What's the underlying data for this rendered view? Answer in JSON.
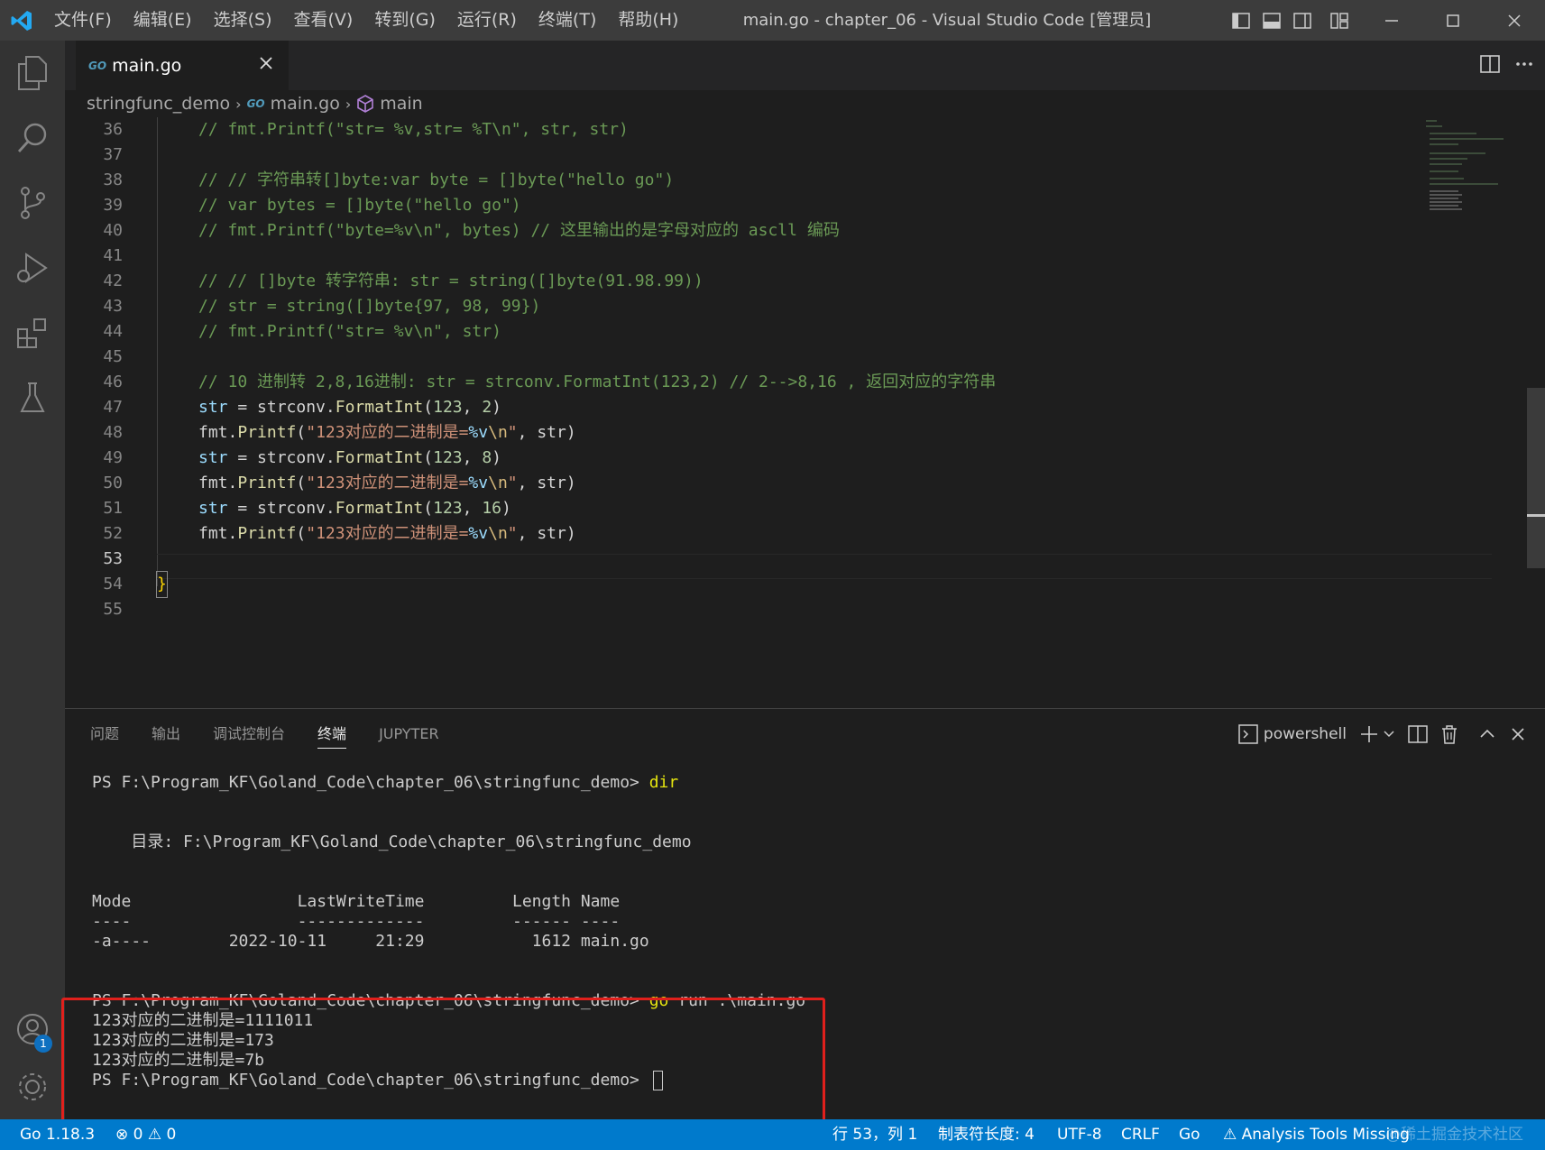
{
  "titlebar": {
    "menu": [
      "文件(F)",
      "编辑(E)",
      "选择(S)",
      "查看(V)",
      "转到(G)",
      "运行(R)",
      "终端(T)",
      "帮助(H)"
    ],
    "window_title": "main.go - chapter_06 - Visual Studio Code [管理员]"
  },
  "activitybar": {
    "items": [
      "explorer-icon",
      "search-icon",
      "source-control-icon",
      "run-debug-icon",
      "extensions-icon",
      "testing-icon"
    ],
    "accounts_badge": "1"
  },
  "editor_tab": {
    "go_tag": "GO",
    "label": "main.go"
  },
  "breadcrumb": {
    "folder": "stringfunc_demo",
    "file": "main.go",
    "symbol": "main"
  },
  "code": {
    "line_numbers": [
      "36",
      "37",
      "38",
      "39",
      "40",
      "41",
      "42",
      "43",
      "44",
      "45",
      "46",
      "47",
      "48",
      "49",
      "50",
      "51",
      "52",
      "53",
      "54",
      "55"
    ],
    "l36": "// fmt.Printf(\"str= %v,str= %T\\n\", str, str)",
    "l38": "// // 字符串转[]byte:var byte = []byte(\"hello go\")",
    "l39": "// var bytes = []byte(\"hello go\")",
    "l40": "// fmt.Printf(\"byte=%v\\n\", bytes) // 这里输出的是字母对应的 ascll 编码",
    "l42": "// // []byte 转字符串: str = string([]byte(91.98.99))",
    "l43": "// str = string([]byte{97, 98, 99})",
    "l44": "// fmt.Printf(\"str= %v\\n\", str)",
    "l46": "// 10 进制转 2,8,16进制: str = strconv.FormatInt(123,2) // 2-->8,16 , 返回对应的字符串",
    "tokens": {
      "str": "str",
      "assign": " = ",
      "strconv": "strconv.",
      "formatint": "FormatInt",
      "open": "(",
      "num123": "123",
      "comma": ", ",
      "base2": "2",
      "base8": "8",
      "base16": "16",
      "close": ")",
      "fmt": "fmt.",
      "printf": "Printf",
      "str_body": "\"123对应的二进制是=",
      "verb": "%v",
      "escape": "\\n",
      "quote": "\"",
      "args_tail": ", str)"
    },
    "l54": "}"
  },
  "panel": {
    "tabs": [
      "问题",
      "输出",
      "调试控制台",
      "终端",
      "JUPYTER"
    ],
    "active_tab": "终端",
    "shell": "powershell"
  },
  "terminal": {
    "prompt": "PS F:\\Program_KF\\Goland_Code\\chapter_06\\stringfunc_demo> ",
    "cmd1": "dir",
    "directory": "    目录: F:\\Program_KF\\Goland_Code\\chapter_06\\stringfunc_demo",
    "header": "Mode                 LastWriteTime         Length Name",
    "underline": "----                 -------------         ------ ----",
    "row": "-a----        2022-10-11     21:29           1612 main.go",
    "cmd2_go": "go",
    "cmd2_rest": " run .\\main.go",
    "out1": "123对应的二进制是=1111011",
    "out2": "123对应的二进制是=173",
    "out3": "123对应的二进制是=7b"
  },
  "statusbar": {
    "go_version": "Go 1.18.3",
    "errors": "0",
    "warnings": "0",
    "position": "行 53，列 1",
    "tab_size": "制表符长度: 4",
    "encoding": "UTF-8",
    "eol": "CRLF",
    "language": "Go",
    "analysis": "Analysis Tools Missing",
    "watermark": "@稀土掘金技术社区"
  },
  "colors": {
    "accent": "#007acc",
    "highlight_box": "#e0201c",
    "comment": "#6a9955",
    "string": "#ce9178",
    "function": "#dcdcaa",
    "variable": "#9cdcfe",
    "number": "#b5cea8"
  }
}
